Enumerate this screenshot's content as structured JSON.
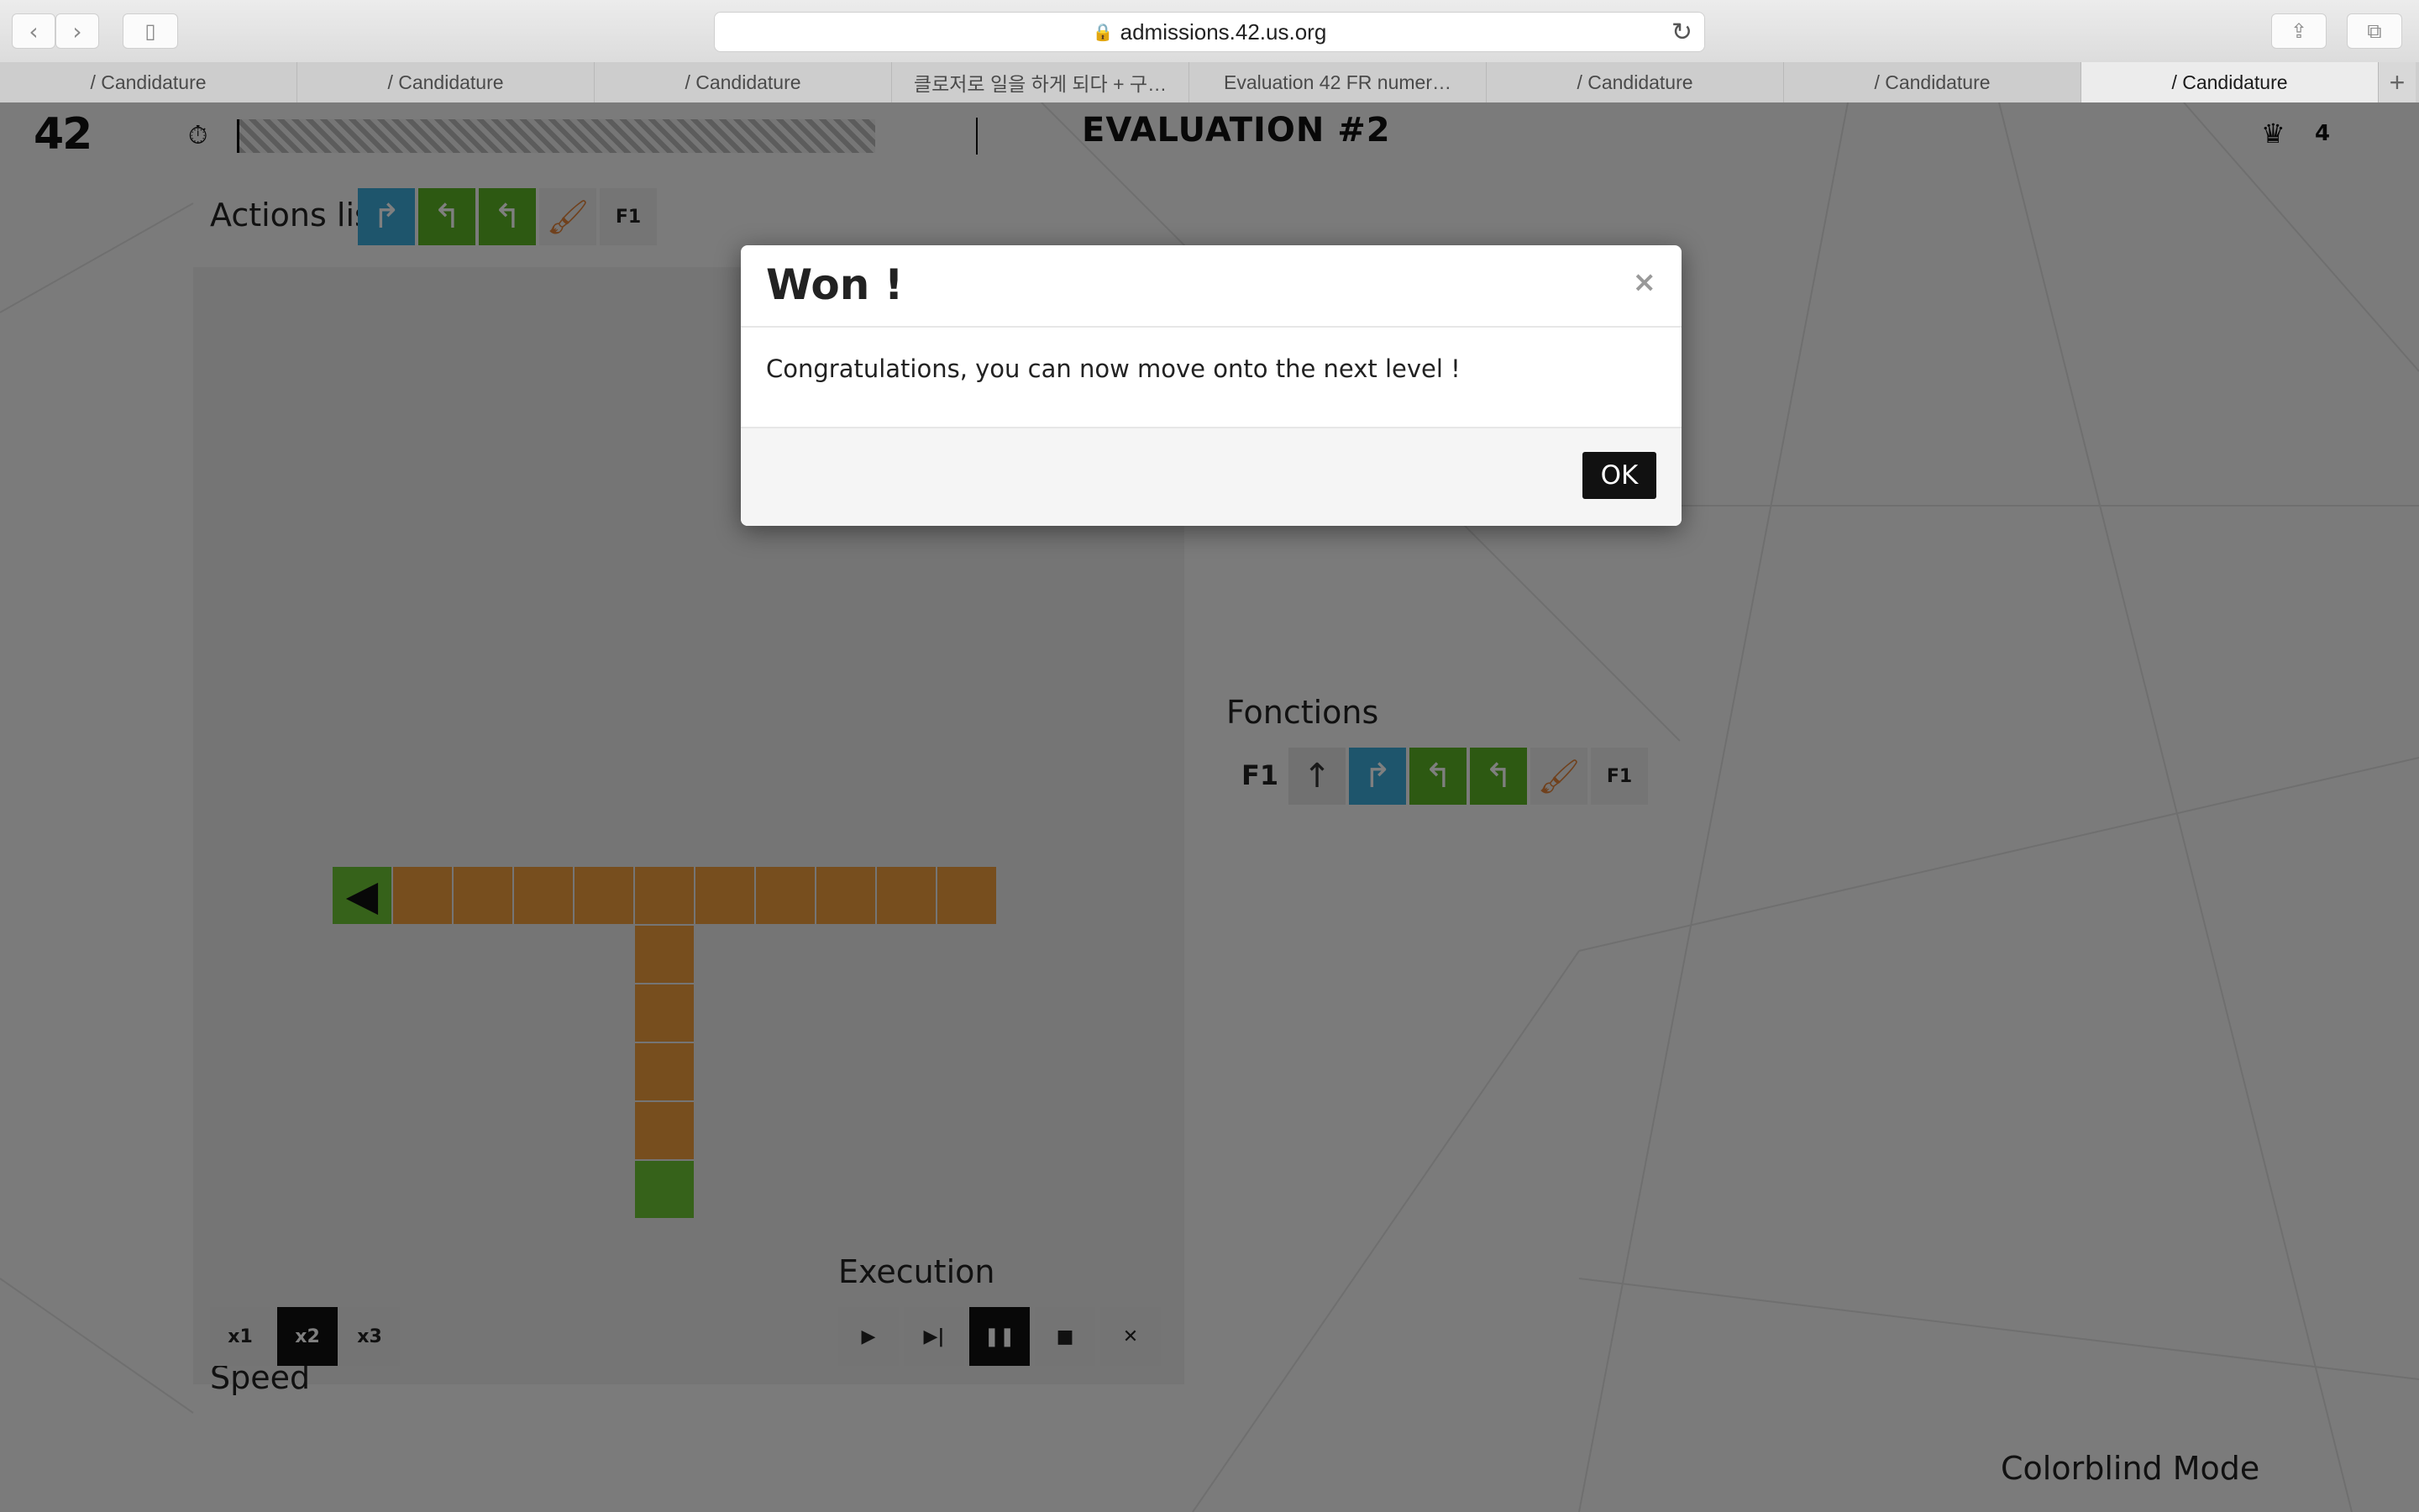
{
  "browser": {
    "url": "admissions.42.us.org",
    "tabs": [
      "/ Candidature",
      "/ Candidature",
      "/ Candidature",
      "클로저로 일을 하게 되다 + 구…",
      "Evaluation 42 FR numer…",
      "/ Candidature",
      "/ Candidature",
      "/ Candidature"
    ],
    "new_tab": "+"
  },
  "header": {
    "logo": "42",
    "title": "EVALUATION #2",
    "crown_count": "4"
  },
  "actions": {
    "label": "Actions list",
    "items": [
      {
        "icon": "turn-right-icon",
        "glyph": "↱",
        "color": "#3daad8"
      },
      {
        "icon": "turn-left-icon",
        "glyph": "↰",
        "color": "#5ab224"
      },
      {
        "icon": "turn-left-icon",
        "glyph": "↰",
        "color": "#5ab224"
      },
      {
        "icon": "paint-brush-icon",
        "glyph": "🖌"
      },
      {
        "icon": "function-f1",
        "glyph": "F1"
      }
    ]
  },
  "speed": {
    "label": "Speed",
    "options": [
      "x1",
      "x2",
      "x3"
    ],
    "selected": "x2"
  },
  "execution": {
    "label": "Execution",
    "buttons": [
      {
        "icon": "play-icon",
        "glyph": "▶"
      },
      {
        "icon": "step-icon",
        "glyph": "▶|"
      },
      {
        "icon": "pause-icon",
        "glyph": "❚❚"
      },
      {
        "icon": "stop-icon",
        "glyph": "■"
      },
      {
        "icon": "clear-icon",
        "glyph": "✕"
      }
    ],
    "active": "pause-icon"
  },
  "functions": {
    "label": "Fonctions",
    "f1_label": "F1",
    "slots": [
      {
        "icon": "forward-icon",
        "glyph": "↑"
      },
      {
        "icon": "turn-right-icon",
        "glyph": "↱",
        "color": "#3daad8"
      },
      {
        "icon": "turn-left-icon",
        "glyph": "↰",
        "color": "#5ab224"
      },
      {
        "icon": "turn-left-icon",
        "glyph": "↰",
        "color": "#5ab224"
      },
      {
        "icon": "paint-brush-icon",
        "glyph": "🖌"
      },
      {
        "icon": "function-f1",
        "glyph": "F1"
      }
    ]
  },
  "footer": {
    "colorblind": "Colorblind Mode"
  },
  "modal": {
    "title": "Won !",
    "close": "×",
    "message": "Congratulations, you can now move onto the next level !",
    "ok": "OK"
  }
}
